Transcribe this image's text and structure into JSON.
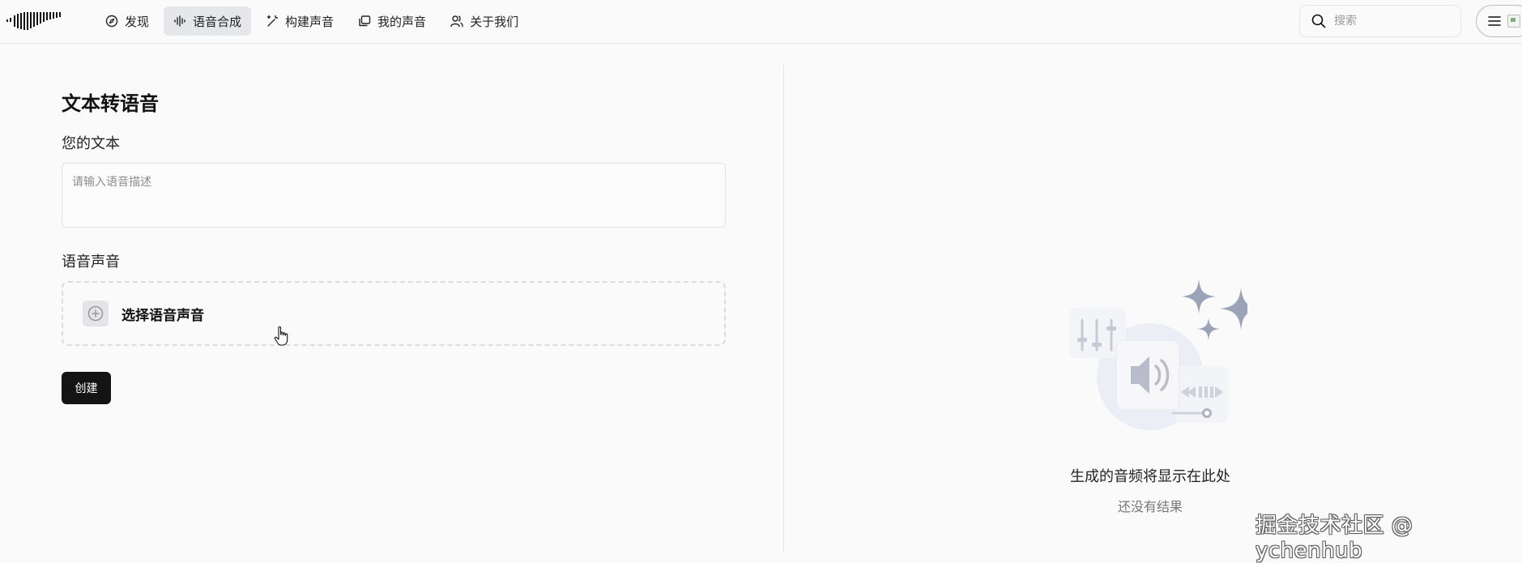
{
  "nav": {
    "items": [
      {
        "label": "发现",
        "icon": "compass-icon",
        "active": false
      },
      {
        "label": "语音合成",
        "icon": "waveform-icon",
        "active": true
      },
      {
        "label": "构建声音",
        "icon": "magic-wand-icon",
        "active": false
      },
      {
        "label": "我的声音",
        "icon": "folder-stack-icon",
        "active": false
      },
      {
        "label": "关于我们",
        "icon": "users-icon",
        "active": false
      }
    ]
  },
  "search": {
    "placeholder": "搜索",
    "value": ""
  },
  "main": {
    "title": "文本转语音",
    "text_label": "您的文本",
    "text_placeholder": "请输入语音描述",
    "text_value": "",
    "voice_label": "语音声音",
    "voice_select_label": "选择语音声音",
    "create_label": "创建"
  },
  "result": {
    "empty_title": "生成的音频将显示在此处",
    "empty_subtitle": "还没有结果"
  },
  "watermark": "掘金技术社区 @ ychenhub",
  "colors": {
    "background": "#fafafa",
    "active_nav": "#e6e7ea",
    "primary_button": "#141414",
    "illustration_accent": "#9aa3b8"
  }
}
